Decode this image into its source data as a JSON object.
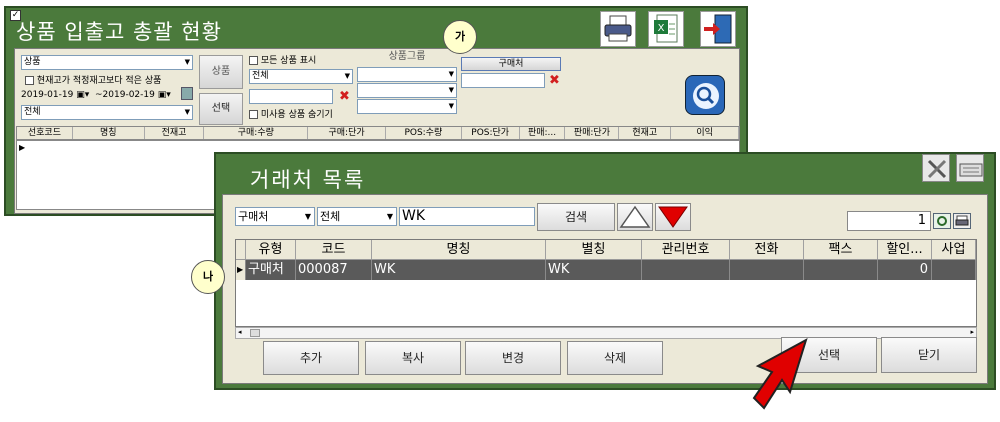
{
  "back_window": {
    "title": "상품 입출고 총괄 현황",
    "product_combo": "상품",
    "chk_below_proper_stock": "현재고가 적정재고보다 적은 상품",
    "date_from": "2019-01-19",
    "date_to": "~2019-02-19",
    "all_combo": "전체",
    "product_btn": "상품",
    "select_btn": "선택",
    "chk_show_all_products": "모든 상품 표시",
    "all_combo2": "전체",
    "chk_hide_unused": "미사용 상품 숨기기",
    "product_group_label": "상품그룹",
    "vendor_btn": "구매처",
    "grid_columns": [
      "선호코드",
      "명칭",
      "전재고",
      "구매:수량",
      "구매:단가",
      "POS:수량",
      "POS:단가",
      "판매:...",
      "판매:단가",
      "현재고",
      "이익"
    ]
  },
  "badges": {
    "ga": "가",
    "na": "나"
  },
  "front_window": {
    "title": "거래처 목록",
    "type_combo": "구매처",
    "scope_combo": "전체",
    "search_value": "WK",
    "search_btn": "검색",
    "page_number": "1",
    "grid_columns": [
      "유형",
      "코드",
      "명칭",
      "별칭",
      "관리번호",
      "전화",
      "팩스",
      "할인...",
      "사업"
    ],
    "rows": [
      {
        "type": "구매처",
        "code": "000087",
        "name": "WK",
        "alias": "WK",
        "mgmt_no": "",
        "phone": "",
        "fax": "",
        "discount": "0",
        "biz": ""
      }
    ],
    "buttons": {
      "add": "추가",
      "copy": "복사",
      "change": "변경",
      "delete": "삭제",
      "select": "선택",
      "close": "닫기"
    }
  },
  "colors": {
    "window_green": "#4b7a3c",
    "panel": "#ece9d8",
    "selected_row": "#5a5a5a",
    "arrow_red": "#e00000"
  }
}
